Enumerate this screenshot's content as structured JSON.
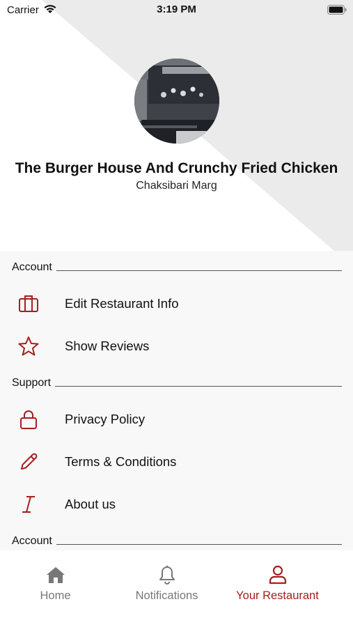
{
  "status_bar": {
    "carrier": "Carrier",
    "time": "3:19 PM"
  },
  "restaurant": {
    "name": "The Burger House And Crunchy Fried Chicken",
    "address": "Chaksibari Marg"
  },
  "sections": [
    {
      "title": "Account",
      "items": [
        {
          "label": "Edit Restaurant Info",
          "icon": "briefcase-icon"
        },
        {
          "label": "Show Reviews",
          "icon": "star-icon"
        }
      ]
    },
    {
      "title": "Support",
      "items": [
        {
          "label": "Privacy Policy",
          "icon": "lock-icon"
        },
        {
          "label": "Terms & Conditions",
          "icon": "pencil-icon"
        },
        {
          "label": "About us",
          "icon": "italic-icon"
        }
      ]
    },
    {
      "title": "Account",
      "items": []
    }
  ],
  "tabs": [
    {
      "label": "Home",
      "icon": "home-icon",
      "active": false
    },
    {
      "label": "Notifications",
      "icon": "bell-icon",
      "active": false
    },
    {
      "label": "Your Restaurant",
      "icon": "user-icon",
      "active": true
    }
  ],
  "colors": {
    "accent": "#a61e1e",
    "inactive": "#777777",
    "list_bg": "#f8f8f8",
    "header_diagonal": "#ebebeb"
  }
}
